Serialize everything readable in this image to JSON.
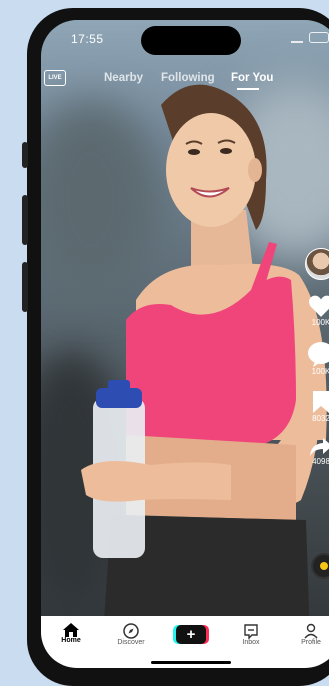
{
  "status": {
    "time": "17:55"
  },
  "topnav": {
    "live_label": "LIVE",
    "tabs": [
      "Nearby",
      "Following",
      "For You"
    ],
    "active_tab": "For You"
  },
  "rail": {
    "likes": "100K",
    "comments": "100K",
    "saves": "8032",
    "shares": "4098"
  },
  "bottom_nav": {
    "home": "Home",
    "discover": "Discover",
    "create": "+",
    "inbox": "Inbox",
    "profile": "Profile"
  },
  "colors": {
    "top_accent": "#25f4ee",
    "red_accent": "#fe2c55",
    "shirt": "#f0457a"
  }
}
